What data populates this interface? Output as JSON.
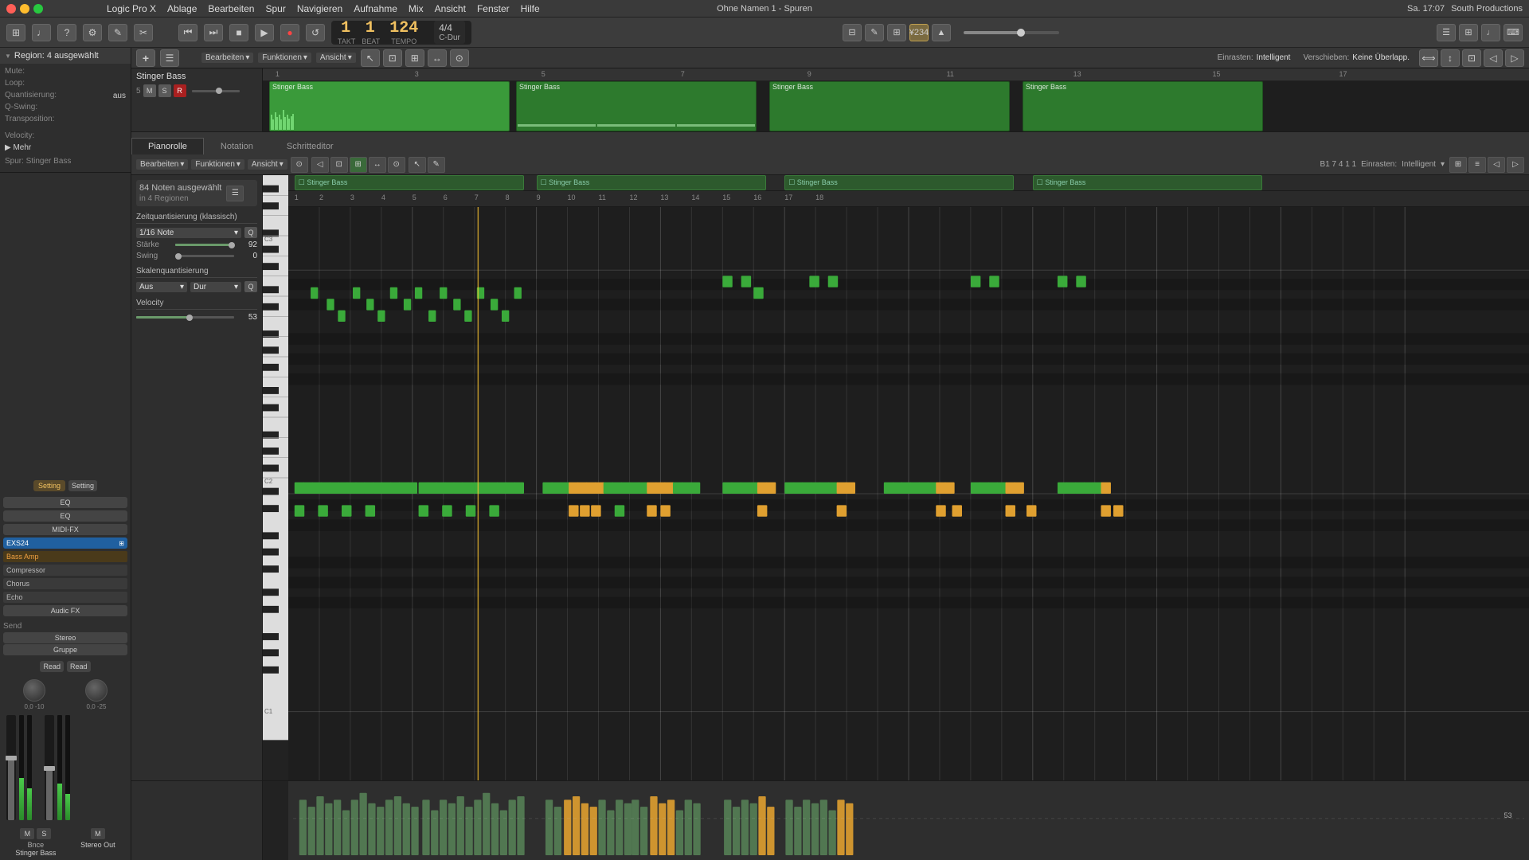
{
  "titlebar": {
    "title": "Ohne Namen 1 - Spuren",
    "app": "Logic Pro X",
    "datetime": "Sa. 17:07",
    "studio": "South Productions",
    "menu": [
      "Logic Pro X",
      "Ablage",
      "Bearbeiten",
      "Spur",
      "Navigieren",
      "Aufnahme",
      "Mix",
      "Ansicht",
      "Fenster",
      "?",
      "Hilfe"
    ]
  },
  "transport": {
    "takt_label": "TAKT",
    "beat_label": "BEAT",
    "tempo_label": "TEMPO",
    "takt": "1",
    "beat": "1",
    "tempo": "124",
    "time_sig": "4/4",
    "key": "C-Dur",
    "rewind_label": "⏮",
    "ff_label": "⏭",
    "stop_label": "■",
    "play_label": "▶",
    "record_label": "●",
    "cycle_label": "↺",
    "display_btn": "¥234"
  },
  "inspector": {
    "region_header": "Region: 4 ausgewählt",
    "mute_label": "Mute:",
    "loop_label": "Loop:",
    "quantize_label": "Quantisierung:",
    "quantize_value": "aus",
    "q_swing_label": "Q-Swing:",
    "transposition_label": "Transposition:",
    "velocity_label": "Velocity:",
    "mehr_label": "Mehr",
    "spur_label": "Spur: Stinger Bass"
  },
  "track": {
    "name": "Stinger Bass",
    "mute": "M",
    "solo": "S",
    "rec": "R",
    "track_number": "5"
  },
  "piano_roll_tabs": {
    "tab1": "Pianorolle",
    "tab2": "Notation",
    "tab3": "Schritteditor",
    "active": "Pianorolle"
  },
  "piano_roll_header": {
    "bearbeiten": "Bearbeiten",
    "funktionen": "Funktionen",
    "ansicht": "Ansicht",
    "position": "B1  7 4 1 1",
    "einrasten": "Einrasten:",
    "einrasten_value": "Intelligent"
  },
  "notes_info": {
    "selected": "84 Noten ausgewählt",
    "regions": "in 4 Regionen"
  },
  "quantize": {
    "zeitquant_title": "Zeitquantisierung (klassisch)",
    "note_value": "1/16 Note",
    "staerke_label": "Stärke",
    "staerke_value": "92",
    "swing_label": "Swing",
    "swing_value": "0",
    "skalenquant_title": "Skalenquantisierung",
    "aus_value": "Aus",
    "dur_value": "Dur",
    "velocity_title": "Velocity",
    "velocity_value": "53"
  },
  "track_toolbar": {
    "bearbeiten": "Bearbeiten",
    "funktionen": "Funktionen",
    "ansicht": "Ansicht",
    "einrasten_label": "Einrasten:",
    "einrasten_value": "Intelligent",
    "verschieben_label": "Verschieben:",
    "verschieben_value": "Keine Überlapp."
  },
  "channel_strip": {
    "plugin1": "Setting",
    "plugin2": "EQ",
    "midifx": "MIDI-FX",
    "exs24": "EXS24",
    "bassamp": "Bass Amp",
    "compressor": "Compressor",
    "chorus": "Chorus",
    "echo": "Echo",
    "audiofx": "Audic FX",
    "send": "Send",
    "stereo": "Stereo",
    "gruppe": "Gruppe",
    "read": "Read",
    "pan_val": "0,0",
    "vol_val": "-10",
    "pan_val2": "0,0",
    "vol_val2": "-25",
    "bounce": "Bnce",
    "track_name": "Stinger Bass",
    "out_name": "Stereo Out",
    "m_btn": "M",
    "s_btn": "S",
    "m_btn2": "M"
  },
  "regions": [
    {
      "label": "Stinger Bass",
      "x_pct": 0,
      "w_pct": 22
    },
    {
      "label": "Stinger Bass",
      "x_pct": 23,
      "w_pct": 20
    },
    {
      "label": "Stinger Bass",
      "x_pct": 44,
      "w_pct": 20
    },
    {
      "label": "Stinger Bass",
      "x_pct": 65,
      "w_pct": 20
    }
  ],
  "pr_regions": [
    {
      "label": "Stinger Bass",
      "x_pct": 0,
      "w_pct": 19
    },
    {
      "label": "Stinger Bass",
      "x_pct": 20,
      "w_pct": 19
    },
    {
      "label": "Stinger Bass",
      "x_pct": 40,
      "w_pct": 19
    },
    {
      "label": "Stinger Bass",
      "x_pct": 60,
      "w_pct": 19
    }
  ],
  "colors": {
    "accent_green": "#3a9a3a",
    "accent_orange": "#e0a030",
    "bg_dark": "#1e1e1e",
    "bg_mid": "#2e2e2e",
    "bg_light": "#3a3a3a"
  }
}
